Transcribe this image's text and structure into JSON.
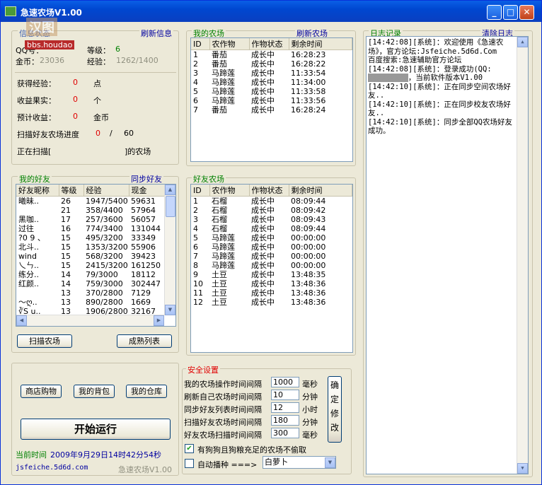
{
  "title": "急速农场V1.00",
  "titlebar": {
    "min": "_",
    "max": "□",
    "close": "✕"
  },
  "status": {
    "header": "信息状态",
    "refresh": "刷新信息",
    "qq_label": "QQ号：",
    "qq_value": "",
    "level_label": "等级：",
    "level_value": "6",
    "gold_label": "金币：",
    "gold_value": "23036",
    "exp_label": "经验：",
    "exp_value": "1262/1400",
    "watermark": "bbs.houdao",
    "gained_exp_label": "获得经验：",
    "gained_exp_value": "0",
    "gained_exp_unit": "点",
    "fruit_label": "收益果实：",
    "fruit_value": "0",
    "fruit_unit": "个",
    "income_label": "预计收益：",
    "income_value": "0",
    "income_unit": "金币",
    "scan_label": "扫描好友农场进度",
    "scan_current": "0",
    "scan_sep": "/",
    "scan_total": "60",
    "scanning_prefix": "正在扫描[",
    "scanning_suffix": "]的农场"
  },
  "myfarm": {
    "header": "我的农场",
    "refresh": "刷新农场",
    "columns": [
      "ID",
      "农作物",
      "作物状态",
      "剩余时间"
    ],
    "rows": [
      [
        "1",
        "番茄",
        "成长中",
        "16:28:23"
      ],
      [
        "2",
        "番茄",
        "成长中",
        "16:28:22"
      ],
      [
        "3",
        "马蹄莲",
        "成长中",
        "11:33:54"
      ],
      [
        "4",
        "马蹄莲",
        "成长中",
        "11:34:00"
      ],
      [
        "5",
        "马蹄莲",
        "成长中",
        "11:33:58"
      ],
      [
        "6",
        "马蹄莲",
        "成长中",
        "11:33:56"
      ],
      [
        "7",
        "番茄",
        "成长中",
        "16:28:24"
      ]
    ]
  },
  "log": {
    "header": "日志记录",
    "clear": "清除日志",
    "lines": [
      "[14:42:08][系统]：欢迎使用《急速农场》，官方论坛:Jsfeiche.5d6d.Com",
      "百度搜索:急速辅助官方论坛",
      "[14:42:08][系统]：登录成功(QQ:",
      "，当前软件版本V1.00",
      "[14:42:10][系统]：正在同步空间农场好友..",
      "[14:42:10][系统]：正在同步校友农场好友..",
      "[14:42:10][系统]：同步全部QQ农场好友成功。"
    ]
  },
  "friends": {
    "header": "我的好友",
    "sync": "同步好友",
    "columns": [
      "好友昵称",
      "等级",
      "经验",
      "现金"
    ],
    "rows": [
      [
        "曦昧..",
        "26",
        "1947/5400",
        "59631"
      ],
      [
        "",
        "21",
        "358/4400",
        "57964"
      ],
      [
        "黑咖..",
        "17",
        "257/3600",
        "56057"
      ],
      [
        "过往",
        "16",
        "774/3400",
        "131044"
      ],
      [
        "?0 9 、",
        "15",
        "495/3200",
        "33349"
      ],
      [
        "北斗..",
        "15",
        "1353/3200",
        "55906"
      ],
      [
        "wind",
        "15",
        "568/3200",
        "39423"
      ],
      [
        "乀ㄣ..",
        "15",
        "2415/3200",
        "161250"
      ],
      [
        "练分..",
        "14",
        "79/3000",
        "18112"
      ],
      [
        "红颜..",
        "14",
        "759/3000",
        "302447"
      ],
      [
        "",
        "13",
        "370/2800",
        "7129"
      ],
      [
        "～ღ..",
        "13",
        "890/2800",
        "1669"
      ],
      [
        "∛S u..",
        "13",
        "1906/2800",
        "32167"
      ]
    ],
    "scan_btn": "扫描农场",
    "mature_btn": "成熟列表"
  },
  "friendfarm": {
    "header": "好友农场",
    "columns": [
      "ID",
      "农作物",
      "作物状态",
      "剩余时间"
    ],
    "rows": [
      [
        "1",
        "石榴",
        "成长中",
        "08:09:44"
      ],
      [
        "2",
        "石榴",
        "成长中",
        "08:09:42"
      ],
      [
        "3",
        "石榴",
        "成长中",
        "08:09:43"
      ],
      [
        "4",
        "石榴",
        "成长中",
        "08:09:44"
      ],
      [
        "5",
        "马蹄莲",
        "成长中",
        "00:00:00"
      ],
      [
        "6",
        "马蹄莲",
        "成长中",
        "00:00:00"
      ],
      [
        "7",
        "马蹄莲",
        "成长中",
        "00:00:00"
      ],
      [
        "8",
        "马蹄莲",
        "成长中",
        "00:00:00"
      ],
      [
        "9",
        "土豆",
        "成长中",
        "13:48:35"
      ],
      [
        "10",
        "土豆",
        "成长中",
        "13:48:36"
      ],
      [
        "11",
        "土豆",
        "成长中",
        "13:48:36"
      ],
      [
        "12",
        "土豆",
        "成长中",
        "13:48:36"
      ]
    ]
  },
  "bottom": {
    "shop": "商店购物",
    "bag": "我的背包",
    "warehouse": "我的仓库",
    "start": "开始运行",
    "time_label": "当前时间",
    "time_value": "2009年9月29日14时42分54秒",
    "site": "jsfeiche.5d6d.com",
    "version": "急速农场V1.00"
  },
  "security": {
    "header": "安全设置",
    "rows": [
      {
        "label": "我的农场操作时间间隔",
        "value": "1000",
        "unit": "毫秒"
      },
      {
        "label": "刷新自己农场时间间隔",
        "value": "10",
        "unit": "分钟"
      },
      {
        "label": "同步好友列表时间间隔",
        "value": "12",
        "unit": "小时"
      },
      {
        "label": "扫描好友农场时间间隔",
        "value": "180",
        "unit": "分钟"
      },
      {
        "label": "好友农场扫描时间间隔",
        "value": "300",
        "unit": "毫秒"
      }
    ],
    "confirm": [
      "确",
      "定",
      "修",
      "改"
    ],
    "dog_check": "有狗狗且狗粮充足的农场不偷取",
    "auto_sow": "自动播种  ===>",
    "seed": "白萝卜"
  }
}
